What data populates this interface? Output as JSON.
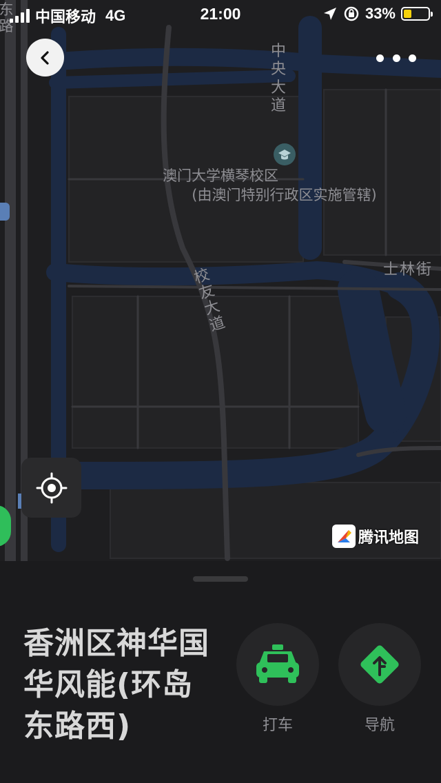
{
  "status_bar": {
    "carrier": "中国移动",
    "network": "4G",
    "time": "21:00",
    "battery_percent": "33%",
    "battery_level": 0.33
  },
  "map": {
    "labels": {
      "road_left": "东路",
      "zhongyang_avenue": "中央大道",
      "campus_name": "澳门大学横琴校区",
      "campus_note": "(由澳门特别行政区实施管辖)",
      "xiaoyou_avenue": "校友大道",
      "shilin_street": "士林街"
    },
    "attribution": "腾讯地图",
    "colors": {
      "background": "#1e1e20",
      "water": "#1c2a44",
      "road": "#3a3a3e",
      "block": "#232325"
    }
  },
  "place": {
    "name": "香洲区神华国华风能(环岛东路西)"
  },
  "actions": {
    "taxi_label": "打车",
    "navigate_label": "导航",
    "accent_color": "#2fc05a"
  },
  "icons": [
    "back-icon",
    "more-icon",
    "locate-icon",
    "taxi-icon",
    "navigate-icon",
    "location-arrow-icon",
    "rotation-lock-icon",
    "campus-icon"
  ]
}
